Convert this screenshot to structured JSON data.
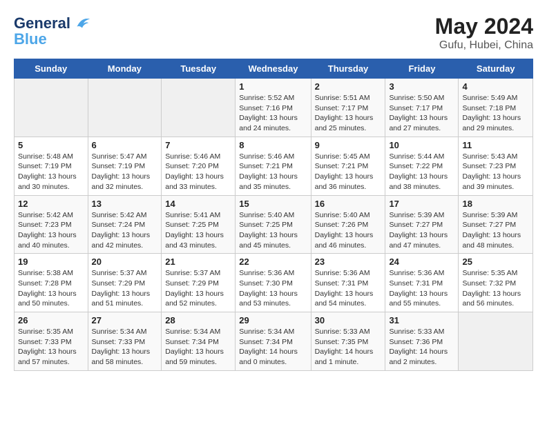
{
  "header": {
    "logo_line1": "General",
    "logo_line2": "Blue",
    "month": "May 2024",
    "location": "Gufu, Hubei, China"
  },
  "days_of_week": [
    "Sunday",
    "Monday",
    "Tuesday",
    "Wednesday",
    "Thursday",
    "Friday",
    "Saturday"
  ],
  "weeks": [
    [
      {
        "day": "",
        "info": ""
      },
      {
        "day": "",
        "info": ""
      },
      {
        "day": "",
        "info": ""
      },
      {
        "day": "1",
        "info": "Sunrise: 5:52 AM\nSunset: 7:16 PM\nDaylight: 13 hours and 24 minutes."
      },
      {
        "day": "2",
        "info": "Sunrise: 5:51 AM\nSunset: 7:17 PM\nDaylight: 13 hours and 25 minutes."
      },
      {
        "day": "3",
        "info": "Sunrise: 5:50 AM\nSunset: 7:17 PM\nDaylight: 13 hours and 27 minutes."
      },
      {
        "day": "4",
        "info": "Sunrise: 5:49 AM\nSunset: 7:18 PM\nDaylight: 13 hours and 29 minutes."
      }
    ],
    [
      {
        "day": "5",
        "info": "Sunrise: 5:48 AM\nSunset: 7:19 PM\nDaylight: 13 hours and 30 minutes."
      },
      {
        "day": "6",
        "info": "Sunrise: 5:47 AM\nSunset: 7:19 PM\nDaylight: 13 hours and 32 minutes."
      },
      {
        "day": "7",
        "info": "Sunrise: 5:46 AM\nSunset: 7:20 PM\nDaylight: 13 hours and 33 minutes."
      },
      {
        "day": "8",
        "info": "Sunrise: 5:46 AM\nSunset: 7:21 PM\nDaylight: 13 hours and 35 minutes."
      },
      {
        "day": "9",
        "info": "Sunrise: 5:45 AM\nSunset: 7:21 PM\nDaylight: 13 hours and 36 minutes."
      },
      {
        "day": "10",
        "info": "Sunrise: 5:44 AM\nSunset: 7:22 PM\nDaylight: 13 hours and 38 minutes."
      },
      {
        "day": "11",
        "info": "Sunrise: 5:43 AM\nSunset: 7:23 PM\nDaylight: 13 hours and 39 minutes."
      }
    ],
    [
      {
        "day": "12",
        "info": "Sunrise: 5:42 AM\nSunset: 7:23 PM\nDaylight: 13 hours and 40 minutes."
      },
      {
        "day": "13",
        "info": "Sunrise: 5:42 AM\nSunset: 7:24 PM\nDaylight: 13 hours and 42 minutes."
      },
      {
        "day": "14",
        "info": "Sunrise: 5:41 AM\nSunset: 7:25 PM\nDaylight: 13 hours and 43 minutes."
      },
      {
        "day": "15",
        "info": "Sunrise: 5:40 AM\nSunset: 7:25 PM\nDaylight: 13 hours and 45 minutes."
      },
      {
        "day": "16",
        "info": "Sunrise: 5:40 AM\nSunset: 7:26 PM\nDaylight: 13 hours and 46 minutes."
      },
      {
        "day": "17",
        "info": "Sunrise: 5:39 AM\nSunset: 7:27 PM\nDaylight: 13 hours and 47 minutes."
      },
      {
        "day": "18",
        "info": "Sunrise: 5:39 AM\nSunset: 7:27 PM\nDaylight: 13 hours and 48 minutes."
      }
    ],
    [
      {
        "day": "19",
        "info": "Sunrise: 5:38 AM\nSunset: 7:28 PM\nDaylight: 13 hours and 50 minutes."
      },
      {
        "day": "20",
        "info": "Sunrise: 5:37 AM\nSunset: 7:29 PM\nDaylight: 13 hours and 51 minutes."
      },
      {
        "day": "21",
        "info": "Sunrise: 5:37 AM\nSunset: 7:29 PM\nDaylight: 13 hours and 52 minutes."
      },
      {
        "day": "22",
        "info": "Sunrise: 5:36 AM\nSunset: 7:30 PM\nDaylight: 13 hours and 53 minutes."
      },
      {
        "day": "23",
        "info": "Sunrise: 5:36 AM\nSunset: 7:31 PM\nDaylight: 13 hours and 54 minutes."
      },
      {
        "day": "24",
        "info": "Sunrise: 5:36 AM\nSunset: 7:31 PM\nDaylight: 13 hours and 55 minutes."
      },
      {
        "day": "25",
        "info": "Sunrise: 5:35 AM\nSunset: 7:32 PM\nDaylight: 13 hours and 56 minutes."
      }
    ],
    [
      {
        "day": "26",
        "info": "Sunrise: 5:35 AM\nSunset: 7:33 PM\nDaylight: 13 hours and 57 minutes."
      },
      {
        "day": "27",
        "info": "Sunrise: 5:34 AM\nSunset: 7:33 PM\nDaylight: 13 hours and 58 minutes."
      },
      {
        "day": "28",
        "info": "Sunrise: 5:34 AM\nSunset: 7:34 PM\nDaylight: 13 hours and 59 minutes."
      },
      {
        "day": "29",
        "info": "Sunrise: 5:34 AM\nSunset: 7:34 PM\nDaylight: 14 hours and 0 minutes."
      },
      {
        "day": "30",
        "info": "Sunrise: 5:33 AM\nSunset: 7:35 PM\nDaylight: 14 hours and 1 minute."
      },
      {
        "day": "31",
        "info": "Sunrise: 5:33 AM\nSunset: 7:36 PM\nDaylight: 14 hours and 2 minutes."
      },
      {
        "day": "",
        "info": ""
      }
    ]
  ]
}
